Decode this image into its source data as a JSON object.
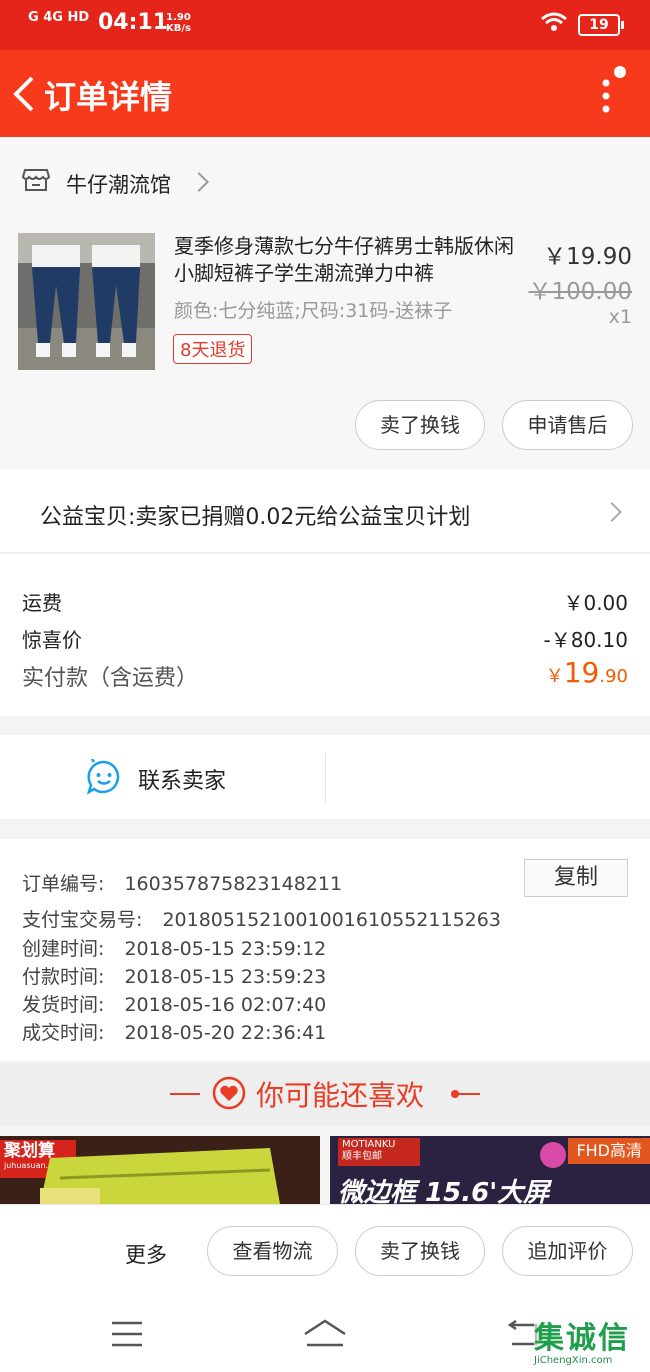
{
  "status_bar": {
    "signal": "G 4G HD",
    "time": "04:11",
    "rate": "1.90",
    "rate_unit": "KB/s",
    "battery": "19"
  },
  "nav": {
    "title": "订单详情",
    "back_icon": "back-chevron-icon",
    "more_icon": "more-vertical-icon"
  },
  "shop": {
    "name": "牛仔潮流馆",
    "icon": "store-icon"
  },
  "item": {
    "title": "夏季修身薄款七分牛仔裤男士韩版休闲小脚短裤子学生潮流弹力中裤",
    "sku": "颜色:七分纯蓝;尺码:31码-送袜子",
    "badge": "8天退货",
    "price": "￥19.90",
    "original_price": "￥100.00",
    "quantity": "x1",
    "sell_button": "卖了换钱",
    "after_sale_button": "申请售后"
  },
  "charity": {
    "text": "公益宝贝:卖家已捐赠0.02元给公益宝贝计划"
  },
  "fees": {
    "shipping_label": "运费",
    "shipping_value": "￥0.00",
    "discount_label": "惊喜价",
    "discount_value": "-￥80.10",
    "total_label": "实付款（含运费）",
    "total_symbol": "￥",
    "total_int": "19",
    "total_dec": ".90"
  },
  "contact": {
    "label": "联系卖家",
    "icon": "chat-bubble-icon"
  },
  "order_info": {
    "order_no_label": "订单编号:",
    "order_no": "160357875823148211",
    "copy_button": "复制",
    "alipay_label": "支付宝交易号:",
    "alipay_no": "2018051521001001610552115263",
    "created_label": "创建时间:",
    "created": "2018-05-15 23:59:12",
    "paid_label": "付款时间:",
    "paid": "2018-05-15 23:59:23",
    "shipped_label": "发货时间:",
    "shipped": "2018-05-16 02:07:40",
    "completed_label": "成交时间:",
    "completed": "2018-05-20 22:36:41"
  },
  "recommend": {
    "title": "你可能还喜欢",
    "banner_left": {
      "brand": "聚划算",
      "domain": "juhuasuan.com"
    },
    "banner_right": {
      "brand": "MOTIANKU",
      "sub": "顺丰包邮",
      "tag": "FHD高清",
      "headline": "微边框 15.6'大屏"
    }
  },
  "bottom_bar": {
    "more": "更多",
    "logistics": "查看物流",
    "sell": "卖了换钱",
    "review": "追加评价"
  },
  "watermark": {
    "text": "集诚信",
    "domain": "JiChengXin.com"
  },
  "colors": {
    "brand_red": "#f83a1c",
    "status_red": "#e6251a",
    "price_orange": "#f55a00"
  }
}
